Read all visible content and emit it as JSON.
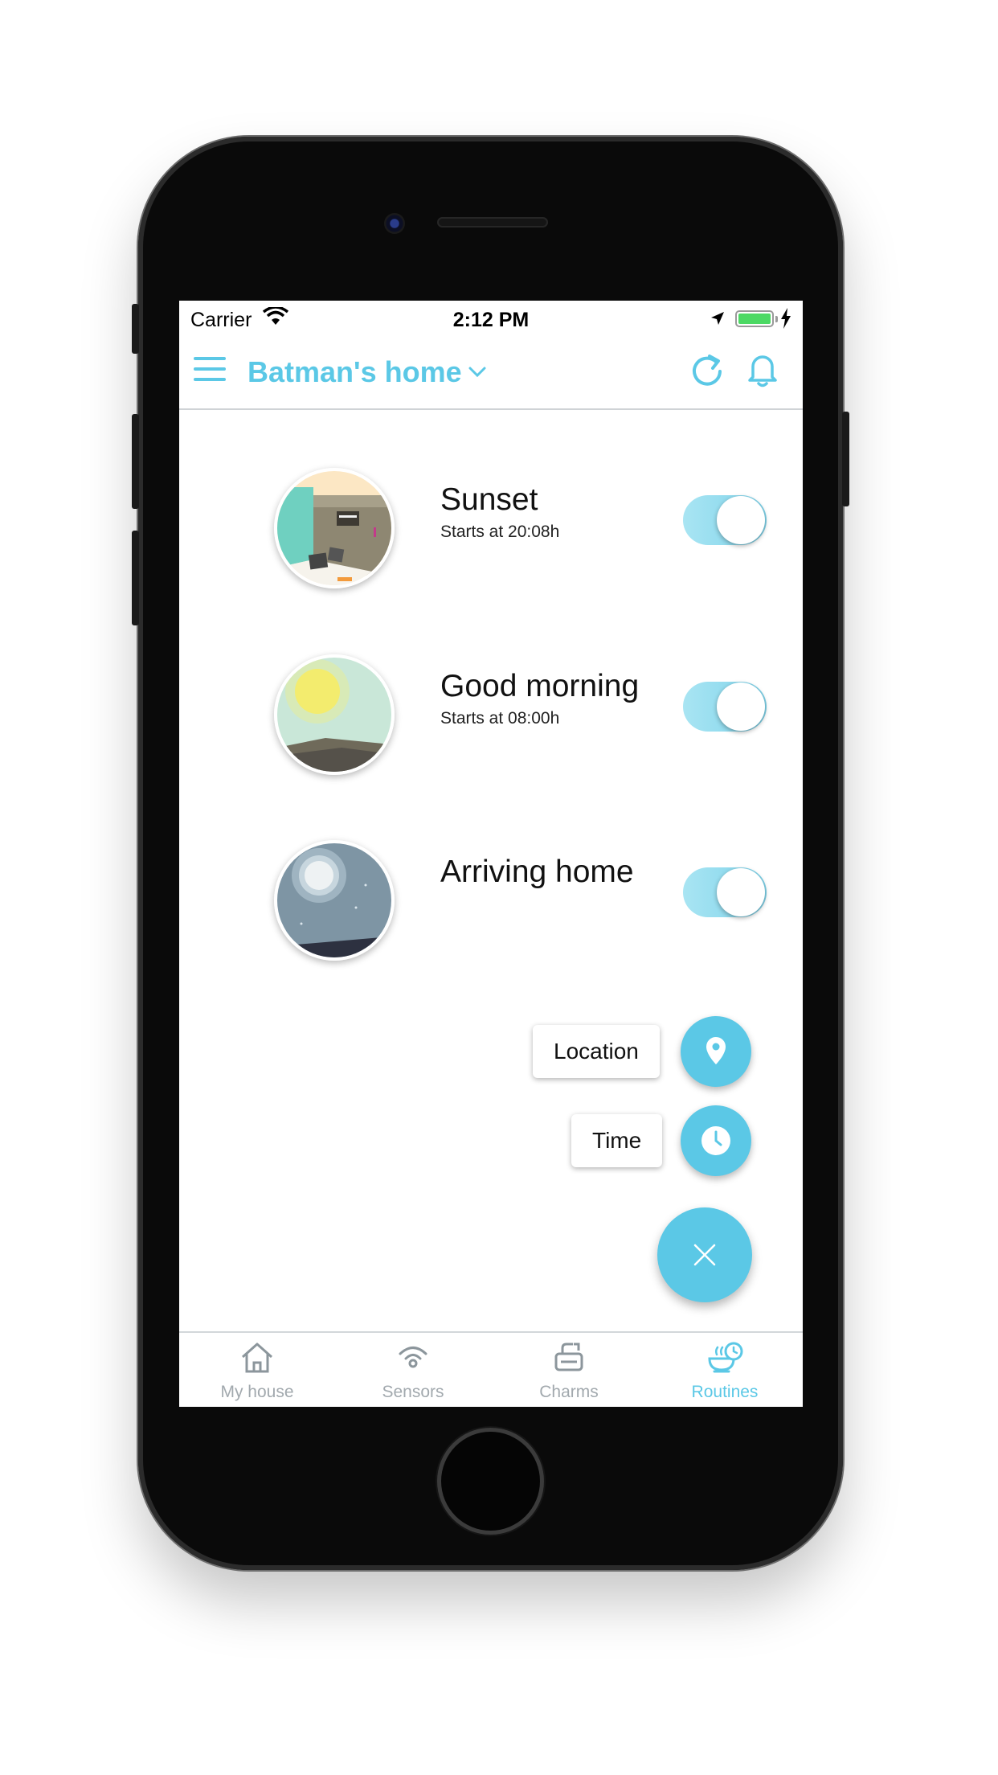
{
  "status_bar": {
    "carrier": "Carrier",
    "time": "2:12 PM",
    "battery_color": "#4cd964",
    "icons": [
      "wifi-icon",
      "location-arrow-icon",
      "battery-icon",
      "charging-bolt-icon"
    ]
  },
  "header": {
    "title": "Batman's home",
    "icons": [
      "menu-icon",
      "chevron-down-icon",
      "refresh-icon",
      "bell-icon"
    ]
  },
  "routines": [
    {
      "name": "Sunset",
      "subtitle": "Starts at 20:08h",
      "enabled": true
    },
    {
      "name": "Good morning",
      "subtitle": "Starts at 08:00h",
      "enabled": true
    },
    {
      "name": "Arriving home",
      "subtitle": "",
      "enabled": true
    }
  ],
  "fab_menu": {
    "location_label": "Location",
    "time_label": "Time",
    "icons": [
      "map-pin-icon",
      "clock-icon",
      "close-icon"
    ]
  },
  "tabs": [
    {
      "label": "My house",
      "icon": "house-icon",
      "active": false
    },
    {
      "label": "Sensors",
      "icon": "signal-icon",
      "active": false
    },
    {
      "label": "Charms",
      "icon": "charms-icon",
      "active": false
    },
    {
      "label": "Routines",
      "icon": "routines-icon",
      "active": true
    }
  ],
  "colors": {
    "accent": "#5bc8e6",
    "toggle_on": "#a9e5f3",
    "inactive_tab": "#a2a9ae"
  }
}
